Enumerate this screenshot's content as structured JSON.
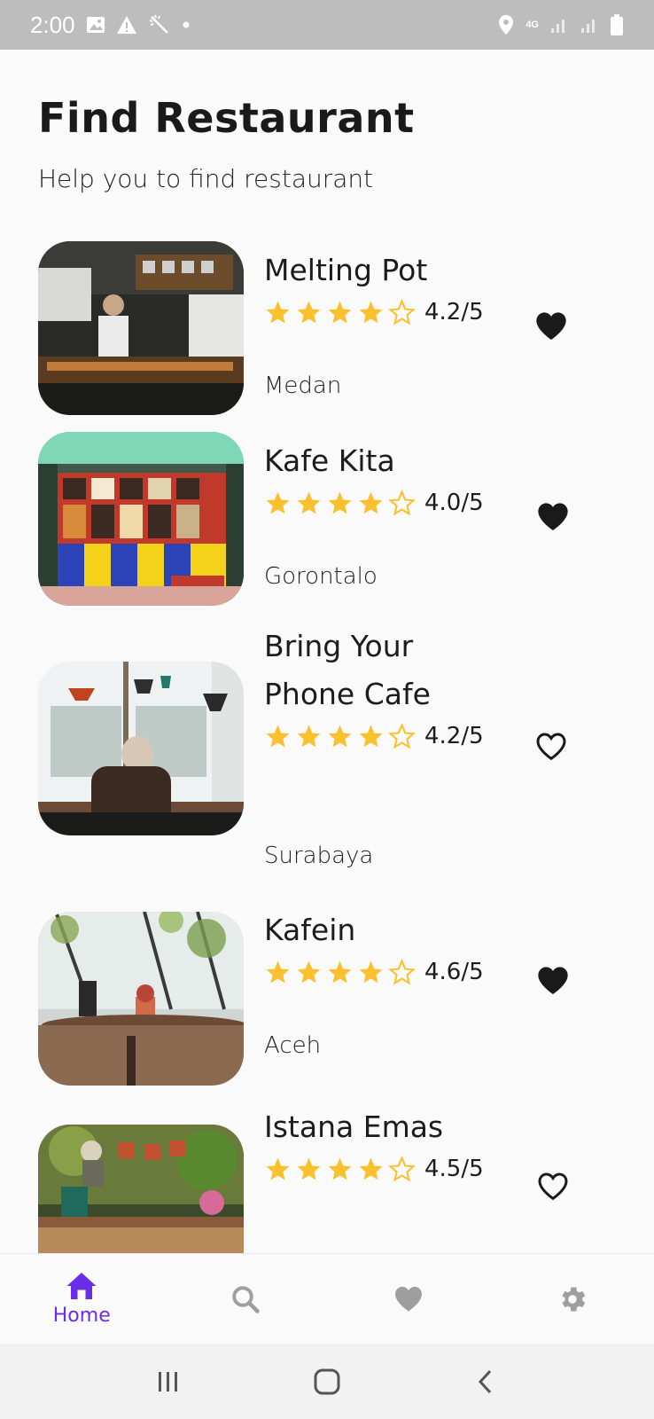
{
  "status_bar": {
    "time": "2:00",
    "network": "4G"
  },
  "header": {
    "title": "Find Restaurant",
    "subtitle": "Help you to find restaurant"
  },
  "restaurants": [
    {
      "name": "Melting Pot",
      "rating": "4.2/5",
      "stars": 4,
      "city": "Medan",
      "favorite": true
    },
    {
      "name": "Kafe Kita",
      "rating": "4.0/5",
      "stars": 4,
      "city": "Gorontalo",
      "favorite": true
    },
    {
      "name": "Bring Your Phone Cafe",
      "rating": "4.2/5",
      "stars": 4,
      "city": "Surabaya",
      "favorite": false
    },
    {
      "name": "Kafein",
      "rating": "4.6/5",
      "stars": 4,
      "city": "Aceh",
      "favorite": true
    },
    {
      "name": "Istana Emas",
      "rating": "4.5/5",
      "stars": 4,
      "city": "",
      "favorite": false
    }
  ],
  "bottom_nav": {
    "items": [
      {
        "icon": "home-icon",
        "label": "Home",
        "active": true
      },
      {
        "icon": "search-icon",
        "label": "",
        "active": false
      },
      {
        "icon": "heart-icon",
        "label": "",
        "active": false
      },
      {
        "icon": "gear-icon",
        "label": "",
        "active": false
      }
    ]
  },
  "colors": {
    "accent": "#6a2ee8",
    "star": "#fbc02d",
    "inactive_icon": "#9e9e9e"
  }
}
